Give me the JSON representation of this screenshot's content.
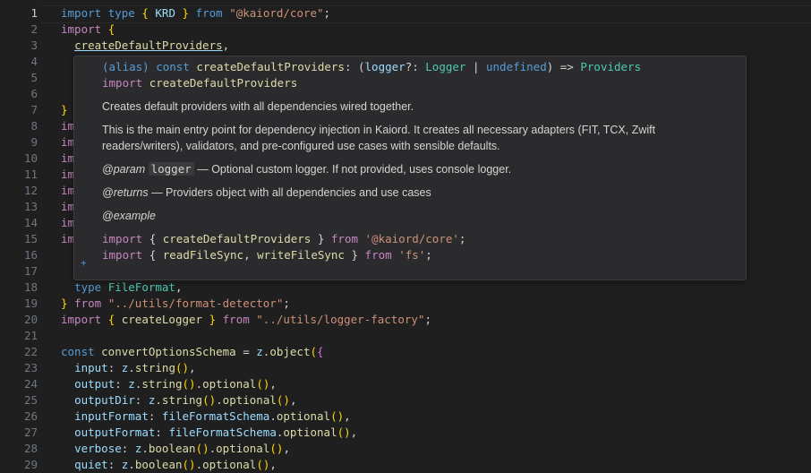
{
  "editor": {
    "lines": [
      {
        "n": "1",
        "parts": [
          [
            "kw",
            "import "
          ],
          [
            "kw",
            "type "
          ],
          [
            "brk",
            "{ "
          ],
          [
            "var",
            "KRD"
          ],
          [
            "brk",
            " }"
          ],
          [
            "kw",
            " from "
          ],
          [
            "str",
            "\"@kaiord/core\""
          ],
          [
            "pun",
            ";"
          ]
        ]
      },
      {
        "n": "2",
        "parts": [
          [
            "kw2",
            "import "
          ],
          [
            "brk",
            "{"
          ]
        ]
      },
      {
        "n": "3",
        "parts": [
          [
            "pun",
            "  "
          ],
          [
            "fn",
            "createDefaultProviders"
          ],
          [
            "pun",
            ","
          ]
        ]
      },
      {
        "n": "4",
        "parts": []
      },
      {
        "n": "5",
        "parts": []
      },
      {
        "n": "6",
        "parts": []
      },
      {
        "n": "7",
        "parts": [
          [
            "brk",
            "}"
          ]
        ]
      },
      {
        "n": "8",
        "parts": [
          [
            "kw2",
            "im"
          ]
        ]
      },
      {
        "n": "9",
        "parts": [
          [
            "kw2",
            "im"
          ]
        ]
      },
      {
        "n": "10",
        "parts": [
          [
            "kw2",
            "im"
          ]
        ]
      },
      {
        "n": "11",
        "parts": [
          [
            "kw2",
            "im"
          ]
        ]
      },
      {
        "n": "12",
        "parts": [
          [
            "kw2",
            "im"
          ]
        ]
      },
      {
        "n": "13",
        "parts": [
          [
            "kw2",
            "im"
          ]
        ]
      },
      {
        "n": "14",
        "parts": [
          [
            "kw2",
            "im"
          ]
        ]
      },
      {
        "n": "15",
        "parts": [
          [
            "kw2",
            "im"
          ]
        ]
      },
      {
        "n": "16",
        "parts": []
      },
      {
        "n": "17",
        "parts": []
      },
      {
        "n": "18",
        "parts": [
          [
            "pun",
            "  "
          ],
          [
            "kw",
            "type "
          ],
          [
            "type",
            "FileFormat"
          ],
          [
            "pun",
            ","
          ]
        ]
      },
      {
        "n": "19",
        "parts": [
          [
            "brk",
            "}"
          ],
          [
            "kw2",
            " from "
          ],
          [
            "str",
            "\"../utils/format-detector\""
          ],
          [
            "pun",
            ";"
          ]
        ]
      },
      {
        "n": "20",
        "parts": [
          [
            "kw2",
            "import "
          ],
          [
            "brk",
            "{ "
          ],
          [
            "fn",
            "createLogger"
          ],
          [
            "brk",
            " }"
          ],
          [
            "kw2",
            " from "
          ],
          [
            "str",
            "\"../utils/logger-factory\""
          ],
          [
            "pun",
            ";"
          ]
        ]
      },
      {
        "n": "21",
        "parts": []
      },
      {
        "n": "22",
        "parts": [
          [
            "kw",
            "const "
          ],
          [
            "fn",
            "convertOptionsSchema"
          ],
          [
            "pun",
            " = "
          ],
          [
            "var",
            "z"
          ],
          [
            "pun",
            "."
          ],
          [
            "fn",
            "object"
          ],
          [
            "brk",
            "("
          ],
          [
            "brk2",
            "{"
          ]
        ]
      },
      {
        "n": "23",
        "parts": [
          [
            "pun",
            "  "
          ],
          [
            "var",
            "input"
          ],
          [
            "pun",
            ": "
          ],
          [
            "var",
            "z"
          ],
          [
            "pun",
            "."
          ],
          [
            "fn",
            "string"
          ],
          [
            "brk",
            "()"
          ],
          [
            "pun",
            ","
          ]
        ]
      },
      {
        "n": "24",
        "parts": [
          [
            "pun",
            "  "
          ],
          [
            "var",
            "output"
          ],
          [
            "pun",
            ": "
          ],
          [
            "var",
            "z"
          ],
          [
            "pun",
            "."
          ],
          [
            "fn",
            "string"
          ],
          [
            "brk",
            "()"
          ],
          [
            "pun",
            "."
          ],
          [
            "fn",
            "optional"
          ],
          [
            "brk",
            "()"
          ],
          [
            "pun",
            ","
          ]
        ]
      },
      {
        "n": "25",
        "parts": [
          [
            "pun",
            "  "
          ],
          [
            "var",
            "outputDir"
          ],
          [
            "pun",
            ": "
          ],
          [
            "var",
            "z"
          ],
          [
            "pun",
            "."
          ],
          [
            "fn",
            "string"
          ],
          [
            "brk",
            "()"
          ],
          [
            "pun",
            "."
          ],
          [
            "fn",
            "optional"
          ],
          [
            "brk",
            "()"
          ],
          [
            "pun",
            ","
          ]
        ]
      },
      {
        "n": "26",
        "parts": [
          [
            "pun",
            "  "
          ],
          [
            "var",
            "inputFormat"
          ],
          [
            "pun",
            ": "
          ],
          [
            "var",
            "fileFormatSchema"
          ],
          [
            "pun",
            "."
          ],
          [
            "fn",
            "optional"
          ],
          [
            "brk",
            "()"
          ],
          [
            "pun",
            ","
          ]
        ]
      },
      {
        "n": "27",
        "parts": [
          [
            "pun",
            "  "
          ],
          [
            "var",
            "outputFormat"
          ],
          [
            "pun",
            ": "
          ],
          [
            "var",
            "fileFormatSchema"
          ],
          [
            "pun",
            "."
          ],
          [
            "fn",
            "optional"
          ],
          [
            "brk",
            "()"
          ],
          [
            "pun",
            ","
          ]
        ]
      },
      {
        "n": "28",
        "parts": [
          [
            "pun",
            "  "
          ],
          [
            "var",
            "verbose"
          ],
          [
            "pun",
            ": "
          ],
          [
            "var",
            "z"
          ],
          [
            "pun",
            "."
          ],
          [
            "fn",
            "boolean"
          ],
          [
            "brk",
            "()"
          ],
          [
            "pun",
            "."
          ],
          [
            "fn",
            "optional"
          ],
          [
            "brk",
            "()"
          ],
          [
            "pun",
            ","
          ]
        ]
      },
      {
        "n": "29",
        "parts": [
          [
            "pun",
            "  "
          ],
          [
            "var",
            "quiet"
          ],
          [
            "pun",
            ": "
          ],
          [
            "var",
            "z"
          ],
          [
            "pun",
            "."
          ],
          [
            "fn",
            "boolean"
          ],
          [
            "brk",
            "()"
          ],
          [
            "pun",
            "."
          ],
          [
            "fn",
            "optional"
          ],
          [
            "brk",
            "()"
          ],
          [
            "pun",
            ","
          ]
        ]
      }
    ]
  },
  "hover": {
    "signature_prefix": "(alias) ",
    "signature_const": "const ",
    "signature_name": "createDefaultProviders",
    "signature_rest_1": ": (",
    "signature_param": "logger",
    "signature_rest_2": "?: ",
    "signature_type": "Logger",
    "signature_pipe": " | ",
    "signature_undef": "undefined",
    "signature_arrow": ") => ",
    "signature_ret": "Providers",
    "import_kw": "import ",
    "import_name": "createDefaultProviders",
    "summary": "Creates default providers with all dependencies wired together.",
    "description_1": "This is the main entry point for dependency injection in Kaiord. It creates all necessary adapters (FIT, TCX, Zwift",
    "description_2": "readers/writers), validators, and pre-configured use cases with sensible defaults.",
    "param_tag": "@param",
    "param_name": "logger",
    "param_desc": " — Optional custom logger. If not provided, uses console logger.",
    "returns_tag": "@returns",
    "returns_desc": " — Providers object with all dependencies and use cases",
    "example_tag": "@example",
    "ex1_import": "import ",
    "ex1_open": "{ ",
    "ex1_name": "createDefaultProviders",
    "ex1_close": " } ",
    "ex1_from": "from ",
    "ex1_str": "'@kaiord/core'",
    "ex1_semi": ";",
    "ex2_import": "import ",
    "ex2_open": "{ ",
    "ex2_name1": "readFileSync",
    "ex2_comma": ", ",
    "ex2_name2": "writeFileSync",
    "ex2_close": " } ",
    "ex2_from": "from ",
    "ex2_str": "'fs'",
    "ex2_semi": ";",
    "plus_glyph": "+"
  },
  "colors": {
    "background": "#1f1f1f",
    "hover_bg": "#2b2b2e",
    "keyword": "#569cd6",
    "control": "#c586c0",
    "string": "#ce9178",
    "function": "#dcdcaa",
    "variable": "#9cdcfe",
    "type": "#4ec9b0"
  }
}
